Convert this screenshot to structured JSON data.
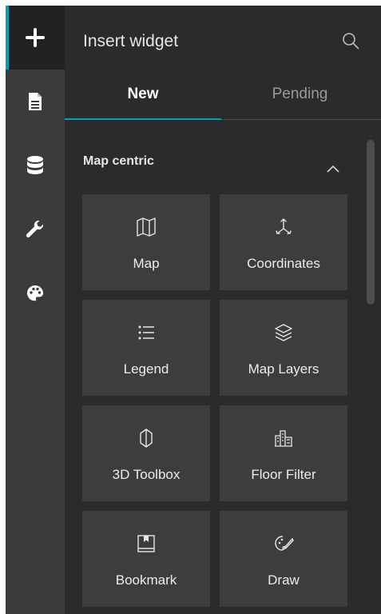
{
  "rail": {
    "items": [
      {
        "name": "insert-widget",
        "icon": "plus-icon"
      },
      {
        "name": "page",
        "icon": "document-icon"
      },
      {
        "name": "data",
        "icon": "database-icon"
      },
      {
        "name": "tools",
        "icon": "wrench-icon"
      },
      {
        "name": "theme",
        "icon": "palette-icon"
      }
    ]
  },
  "header": {
    "title": "Insert widget",
    "search_icon": "search-icon"
  },
  "tabs": {
    "new": "New",
    "pending": "Pending"
  },
  "section": {
    "title": "Map centric",
    "collapse_icon": "chevron-up-icon"
  },
  "widgets": [
    {
      "label": "Map",
      "icon": "map-icon"
    },
    {
      "label": "Coordinates",
      "icon": "coordinates-icon"
    },
    {
      "label": "Legend",
      "icon": "legend-icon"
    },
    {
      "label": "Map Layers",
      "icon": "layers-icon"
    },
    {
      "label": "3D Toolbox",
      "icon": "3d-toolbox-icon"
    },
    {
      "label": "Floor Filter",
      "icon": "floor-filter-icon"
    },
    {
      "label": "Bookmark",
      "icon": "bookmark-icon"
    },
    {
      "label": "Draw",
      "icon": "draw-icon"
    }
  ],
  "colors": {
    "accent": "#00a0b0",
    "panel": "#2b2b2b",
    "rail": "#3b3b3b",
    "card": "#3d3d3d"
  }
}
